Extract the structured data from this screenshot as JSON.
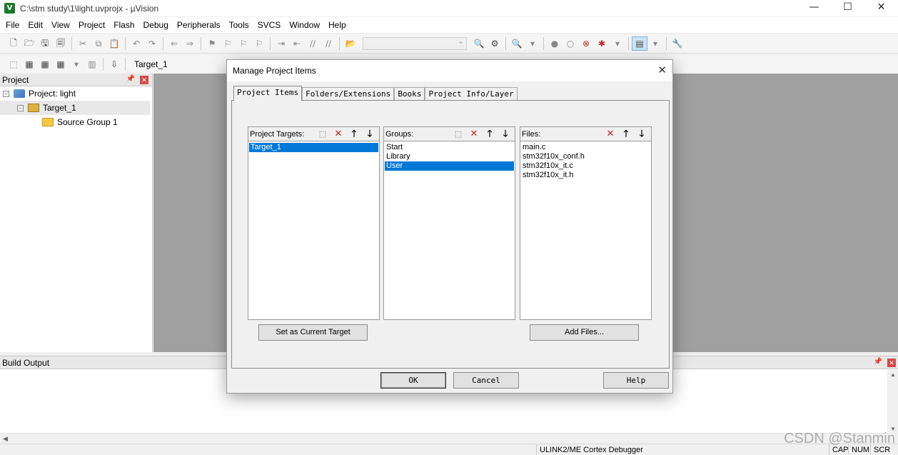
{
  "window": {
    "title": "C:\\stm study\\1\\light.uvprojx - µVision",
    "app_icon_glyph": "V",
    "controls": {
      "minimize": "—",
      "maximize": "☐",
      "close": "✕"
    }
  },
  "menubar": [
    "File",
    "Edit",
    "View",
    "Project",
    "Flash",
    "Debug",
    "Peripherals",
    "Tools",
    "SVCS",
    "Window",
    "Help"
  ],
  "toolbar": {
    "target_name": "Target_1",
    "combo_value": ""
  },
  "project_panel": {
    "title": "Project",
    "tree": {
      "project": {
        "toggle": "−",
        "label": "Project: light"
      },
      "target": {
        "toggle": "−",
        "label": "Target_1"
      },
      "group": {
        "label": "Source Group 1"
      }
    }
  },
  "build_output": {
    "title": "Build Output"
  },
  "statusbar": {
    "debugger": "ULINK2/ME Cortex Debugger",
    "cap": "CAP",
    "num": "NUM",
    "scr": "SCR"
  },
  "watermark": "CSDN @Stanmin",
  "dialog": {
    "title": "Manage Project Items",
    "close": "✕",
    "tabs": [
      "Project Items",
      "Folders/Extensions",
      "Books",
      "Project Info/Layer"
    ],
    "active_tab": 0,
    "targets": {
      "header": "Project Targets:",
      "items": [
        "Target_1"
      ],
      "selected": 0
    },
    "groups": {
      "header": "Groups:",
      "items": [
        "Start",
        "Library",
        "User"
      ],
      "selected": 2
    },
    "files": {
      "header": "Files:",
      "items": [
        "main.c",
        "stm32f10x_conf.h",
        "stm32f10x_it.c",
        "stm32f10x_it.h"
      ],
      "selected": -1
    },
    "buttons": {
      "set_current": "Set as Current Target",
      "add_files": "Add Files...",
      "ok": "OK",
      "cancel": "Cancel",
      "help": "Help"
    },
    "header_icons": {
      "new": "⬚",
      "delete": "✕",
      "up": "🡑",
      "down": "🡓"
    }
  }
}
